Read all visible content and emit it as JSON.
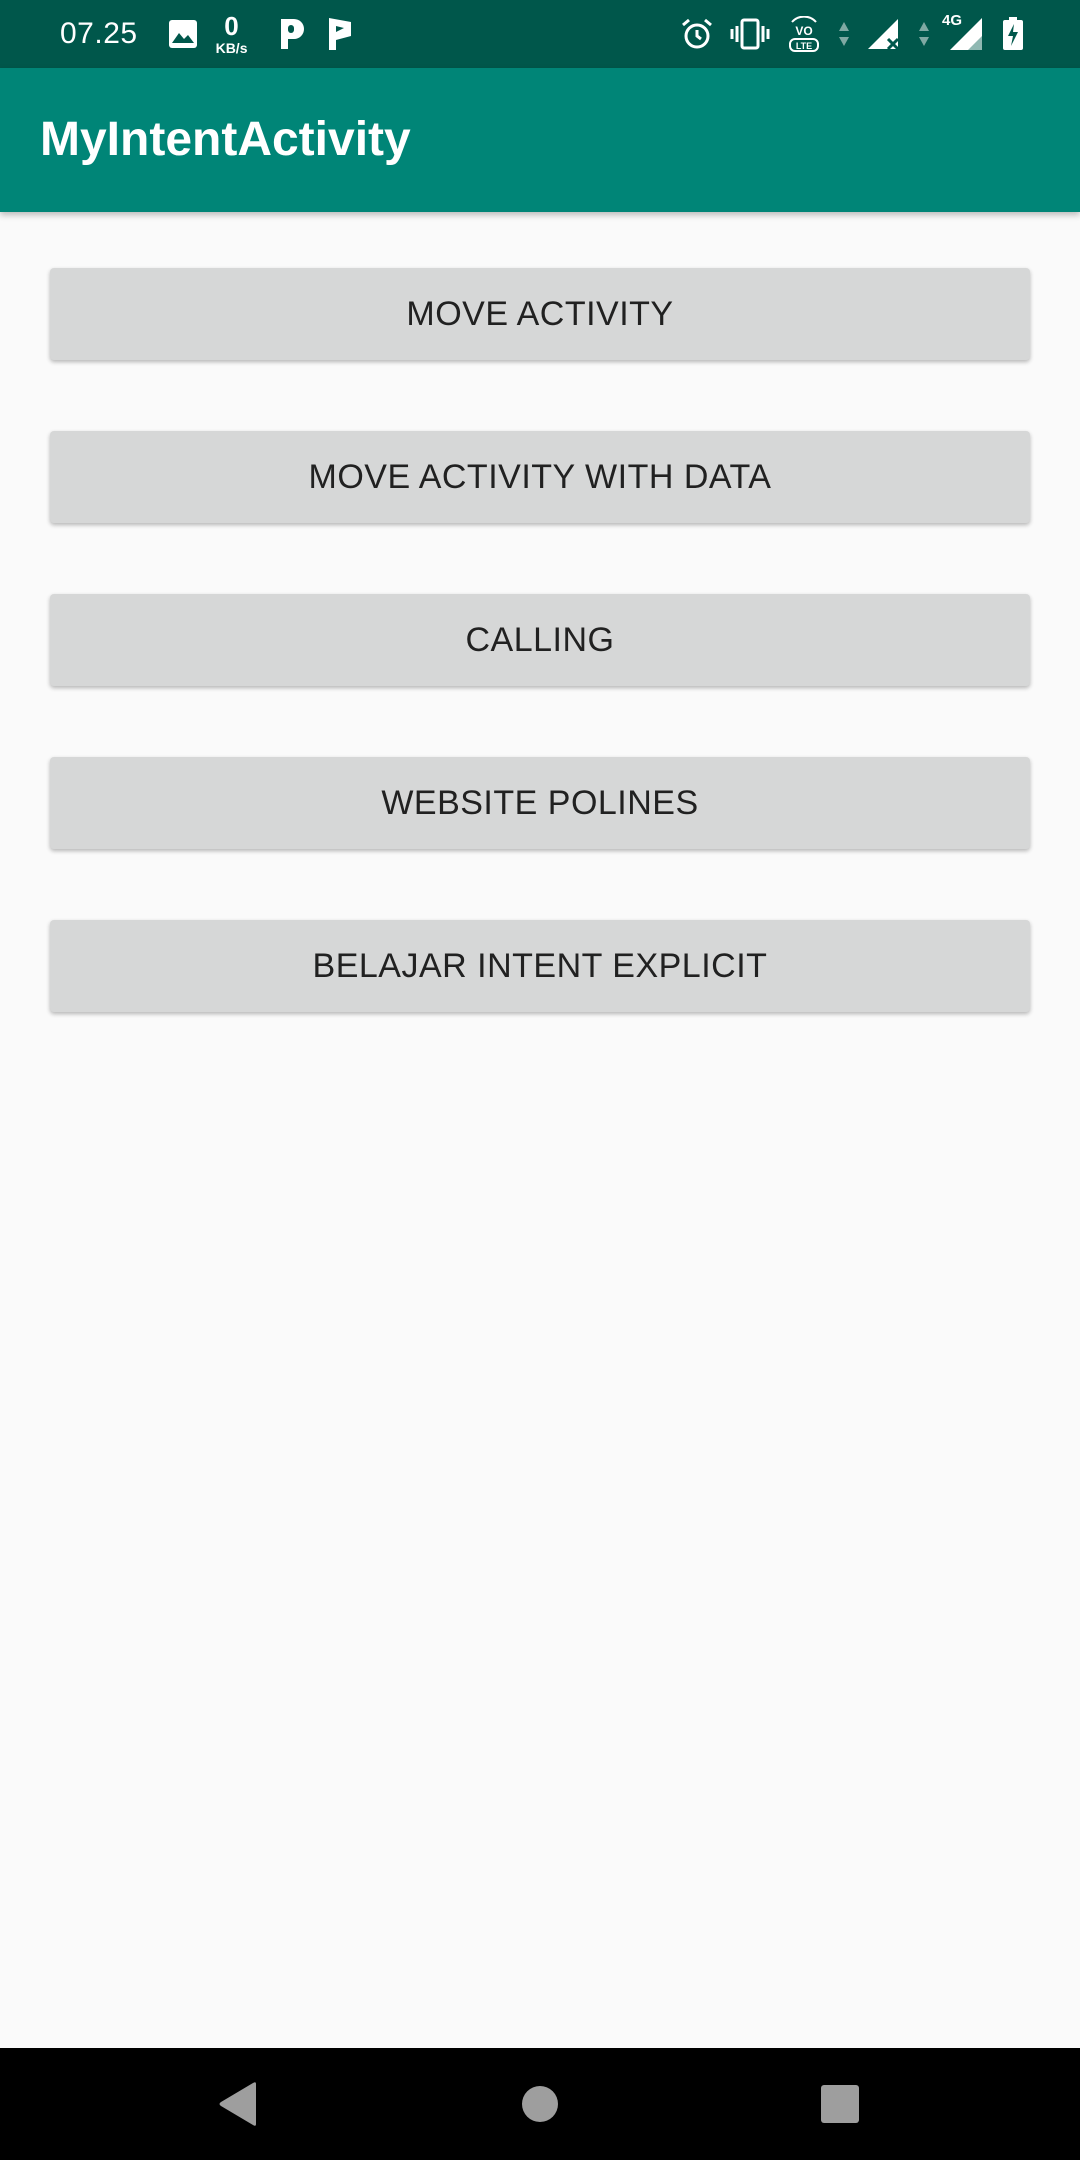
{
  "status_bar": {
    "time": "07.25",
    "net_speed_value": "0",
    "net_speed_unit": "KB/s",
    "network_type": "4G",
    "volte_top": "VO",
    "volte_bottom": "LTE",
    "icons_left": [
      "image-icon",
      "parking-icon",
      "parking-flag-icon"
    ],
    "icons_right": [
      "alarm-icon",
      "vibrate-icon",
      "volte-icon",
      "signal-icon",
      "signal-4g-icon",
      "battery-charging-icon"
    ]
  },
  "app_bar": {
    "title": "MyIntentActivity",
    "color": "#008577",
    "status_color": "#00574b"
  },
  "buttons": [
    {
      "label": "MOVE ACTIVITY"
    },
    {
      "label": "MOVE ACTIVITY WITH DATA"
    },
    {
      "label": "CALLING"
    },
    {
      "label": "WEBSITE POLINES"
    },
    {
      "label": "BELAJAR INTENT EXPLICIT"
    }
  ],
  "nav_bar": {
    "icons": [
      "back-icon",
      "home-icon",
      "recents-icon"
    ]
  }
}
